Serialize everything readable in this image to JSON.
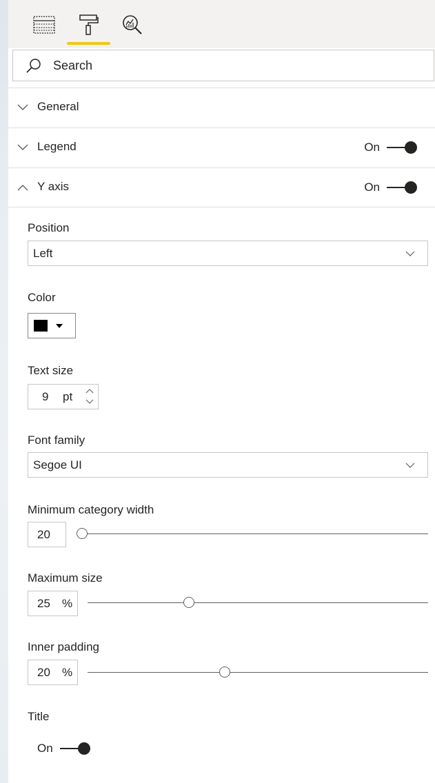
{
  "search": {
    "placeholder": "Search"
  },
  "sections": {
    "general": {
      "title": "General"
    },
    "legend": {
      "title": "Legend",
      "toggle": "On"
    },
    "y_axis": {
      "title": "Y axis",
      "toggle": "On"
    }
  },
  "y_axis": {
    "position": {
      "label": "Position",
      "value": "Left"
    },
    "color": {
      "label": "Color",
      "value": "#000000"
    },
    "text_size": {
      "label": "Text size",
      "value": "9",
      "unit": "pt"
    },
    "font_family": {
      "label": "Font family",
      "value": "Segoe UI"
    },
    "min_category_width": {
      "label": "Minimum category width",
      "value": "20",
      "slider_fraction": 0.0
    },
    "max_size": {
      "label": "Maximum size",
      "value": "25",
      "unit": "%",
      "slider_fraction": 0.29
    },
    "inner_padding": {
      "label": "Inner padding",
      "value": "20",
      "unit": "%",
      "slider_fraction": 0.4
    },
    "title": {
      "label": "Title",
      "toggle": "On"
    }
  },
  "colors": {
    "accent": "#f2c811",
    "text": "#252423",
    "border": "#c8c6c4"
  },
  "icons": [
    "fields-icon",
    "format-paint-roller-icon",
    "analytics-magnifier-icon",
    "search-icon",
    "chevron-down-icon",
    "chevron-up-icon"
  ]
}
